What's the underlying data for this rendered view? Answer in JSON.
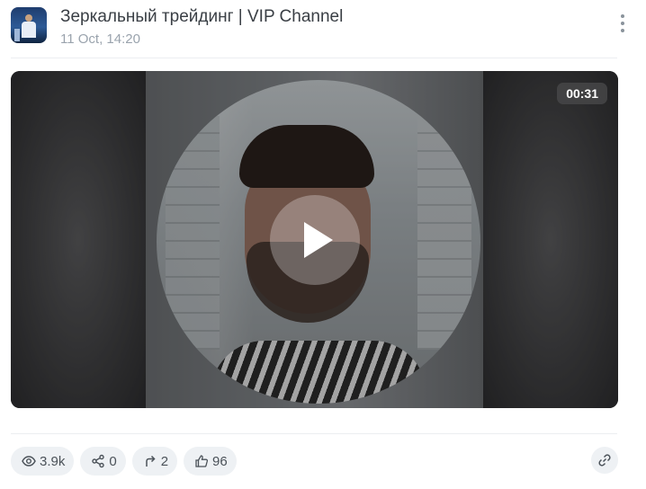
{
  "post": {
    "channel_title": "Зеркальный трейдинг | VIP Channel",
    "date": "11 Oct, 14:20"
  },
  "video": {
    "duration": "00:31"
  },
  "stats": {
    "views": "3.9k",
    "shares": "0",
    "forwards": "2",
    "likes": "96"
  },
  "icons": {
    "menu": "kebab-menu-icon",
    "play": "play-icon",
    "views": "eye-icon",
    "shares": "share-icon",
    "forwards": "forward-arrow-icon",
    "likes": "thumbs-up-icon",
    "link": "link-icon"
  },
  "colors": {
    "pill_background": "#eef1f4",
    "title_text": "#3a3f45",
    "date_text": "#9aa3ad"
  }
}
